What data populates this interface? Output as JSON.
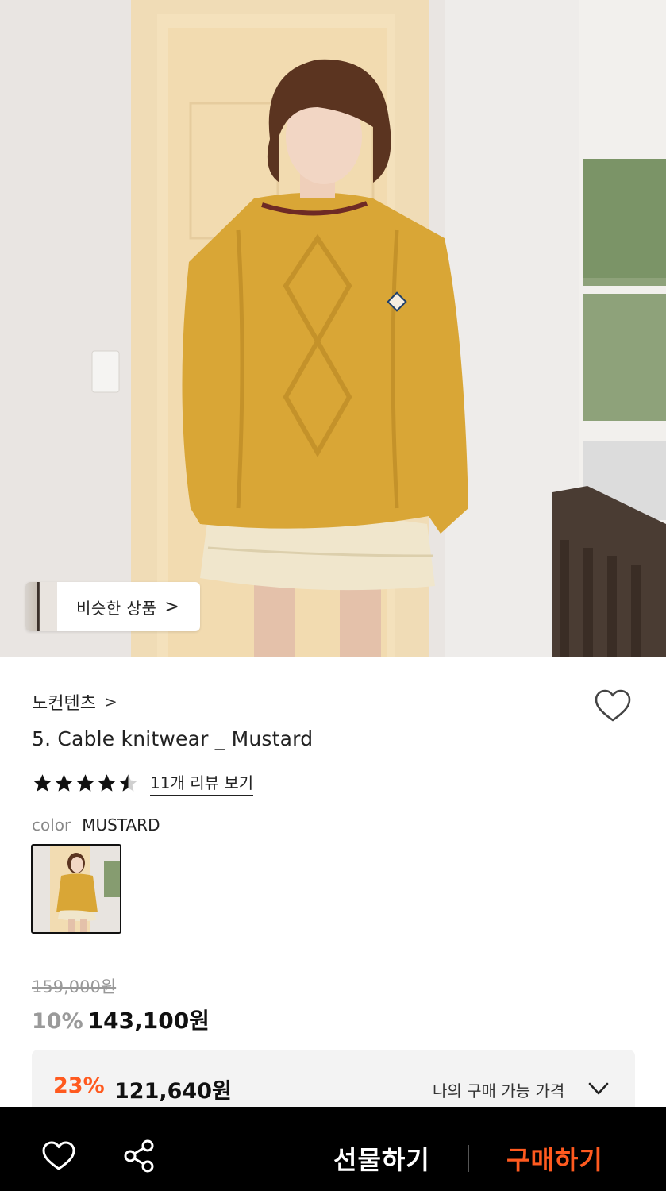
{
  "hero": {
    "image_description_icon": "product-photo",
    "similar_button": {
      "label": "비슷한 상품",
      "chevron": ">"
    }
  },
  "product": {
    "brand": "노컨텐츠",
    "brand_chevron": ">",
    "title": "5. Cable knitwear _ Mustard",
    "rating": 4.5,
    "review_link": "11개 리뷰 보기",
    "option_label": "color",
    "option_value": "MUSTARD",
    "original_price": "159,000원",
    "discount_rate": "10%",
    "sale_price": "143,100원"
  },
  "my_price": {
    "discount_rate": "23%",
    "price": "121,640원",
    "label": "나의 구매 가능 가격"
  },
  "bottom_bar": {
    "gift_label": "선물하기",
    "buy_label": "구매하기"
  },
  "colors": {
    "accent": "#ff5a1f",
    "bar_bg": "#000000",
    "sweater": "#d9a636"
  }
}
